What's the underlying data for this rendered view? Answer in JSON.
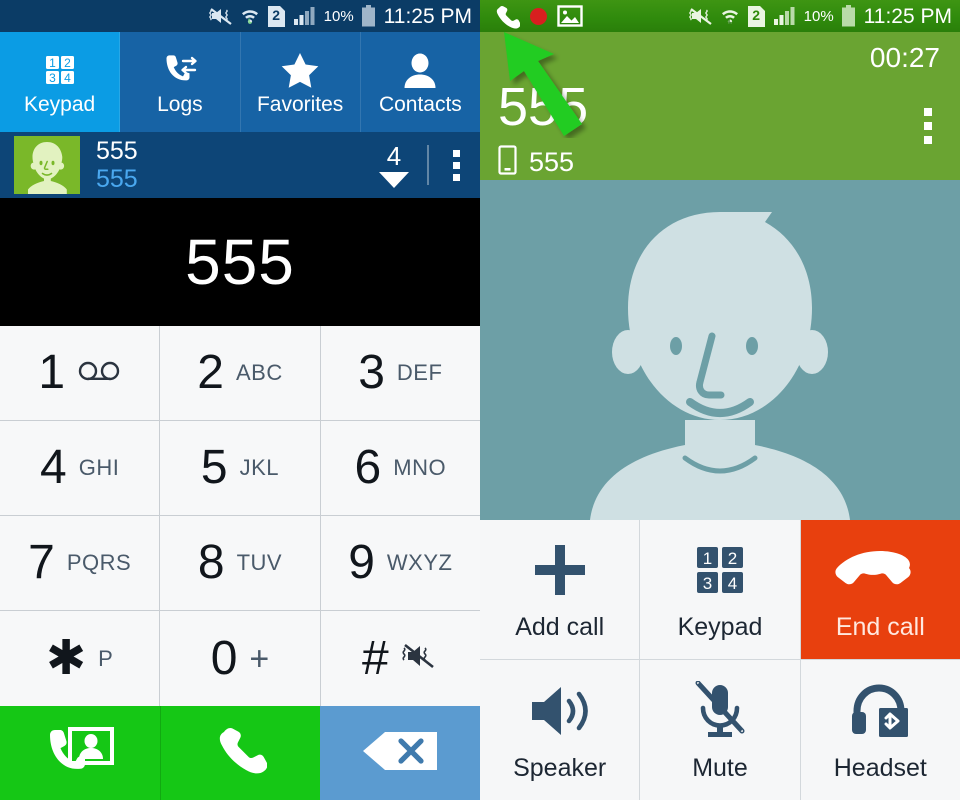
{
  "left_panel": {
    "status_bar": {
      "icons": [
        "mute-icon",
        "wifi-icon",
        "sim2-icon",
        "signal-icon"
      ],
      "sim_label": "2",
      "battery_percent": "10%",
      "clock": "11:25 PM"
    },
    "tabs": [
      {
        "label": "Keypad",
        "icon": "keypad-icon",
        "active": true
      },
      {
        "label": "Logs",
        "icon": "call-logs-icon",
        "active": false
      },
      {
        "label": "Favorites",
        "icon": "star-icon",
        "active": false
      },
      {
        "label": "Contacts",
        "icon": "contact-person-icon",
        "active": false
      }
    ],
    "suggestion": {
      "avatar": "contact-avatar-icon",
      "name": "555",
      "number": "555",
      "match_count": "4",
      "expand_icon": "chevron-down-icon",
      "menu_icon": "overflow-menu-icon"
    },
    "dialed_number": "555",
    "keypad": [
      [
        {
          "digit": "1",
          "sub": "",
          "icon": "voicemail-icon"
        },
        {
          "digit": "2",
          "sub": "ABC",
          "icon": ""
        },
        {
          "digit": "3",
          "sub": "DEF",
          "icon": ""
        }
      ],
      [
        {
          "digit": "4",
          "sub": "GHI",
          "icon": ""
        },
        {
          "digit": "5",
          "sub": "JKL",
          "icon": ""
        },
        {
          "digit": "6",
          "sub": "MNO",
          "icon": ""
        }
      ],
      [
        {
          "digit": "7",
          "sub": "PQRS",
          "icon": ""
        },
        {
          "digit": "8",
          "sub": "TUV",
          "icon": ""
        },
        {
          "digit": "9",
          "sub": "WXYZ",
          "icon": ""
        }
      ],
      [
        {
          "digit": "✱",
          "sub": "P",
          "icon": ""
        },
        {
          "digit": "0",
          "sub": "+",
          "icon": ""
        },
        {
          "digit": "#",
          "sub": "",
          "icon": "silent-mode-icon"
        }
      ]
    ],
    "actions": [
      {
        "name": "video-call-button",
        "icon": "video-call-icon"
      },
      {
        "name": "call-button",
        "icon": "phone-handset-icon"
      },
      {
        "name": "backspace-button",
        "icon": "backspace-icon"
      }
    ]
  },
  "right_panel": {
    "status_bar": {
      "notif_icons": [
        "ongoing-call-icon",
        "recording-dot-icon",
        "screenshot-image-icon"
      ],
      "icons": [
        "mute-icon",
        "wifi-icon",
        "sim2-icon",
        "signal-icon"
      ],
      "sim_label": "2",
      "battery_percent": "10%",
      "clock": "11:25 PM"
    },
    "call": {
      "contact_name": "555",
      "number_type_icon": "mobile-icon",
      "number": "555",
      "duration": "00:27",
      "menu_icon": "overflow-menu-icon",
      "photo": "default-contact-photo"
    },
    "buttons": [
      [
        {
          "label": "Add call",
          "icon": "plus-icon",
          "style": "normal"
        },
        {
          "label": "Keypad",
          "icon": "keypad-icon",
          "style": "normal"
        },
        {
          "label": "End call",
          "icon": "end-call-icon",
          "style": "end"
        }
      ],
      [
        {
          "label": "Speaker",
          "icon": "speaker-icon",
          "style": "normal"
        },
        {
          "label": "Mute",
          "icon": "mic-muted-icon",
          "style": "normal"
        },
        {
          "label": "Headset",
          "icon": "bluetooth-headset-icon",
          "style": "normal"
        }
      ]
    ]
  },
  "annotation": {
    "arrow": "green-pointer-arrow",
    "color": "#22cc22"
  },
  "colors": {
    "tab_active": "#0b9ce4",
    "tab_bar": "#1763a5",
    "status_left": "#0b3c66",
    "call_header_green": "#6aa432",
    "end_call_red": "#e8400e",
    "call_green": "#15c715",
    "backspace_blue": "#5b9bd0",
    "icon_slate": "#33526e"
  }
}
